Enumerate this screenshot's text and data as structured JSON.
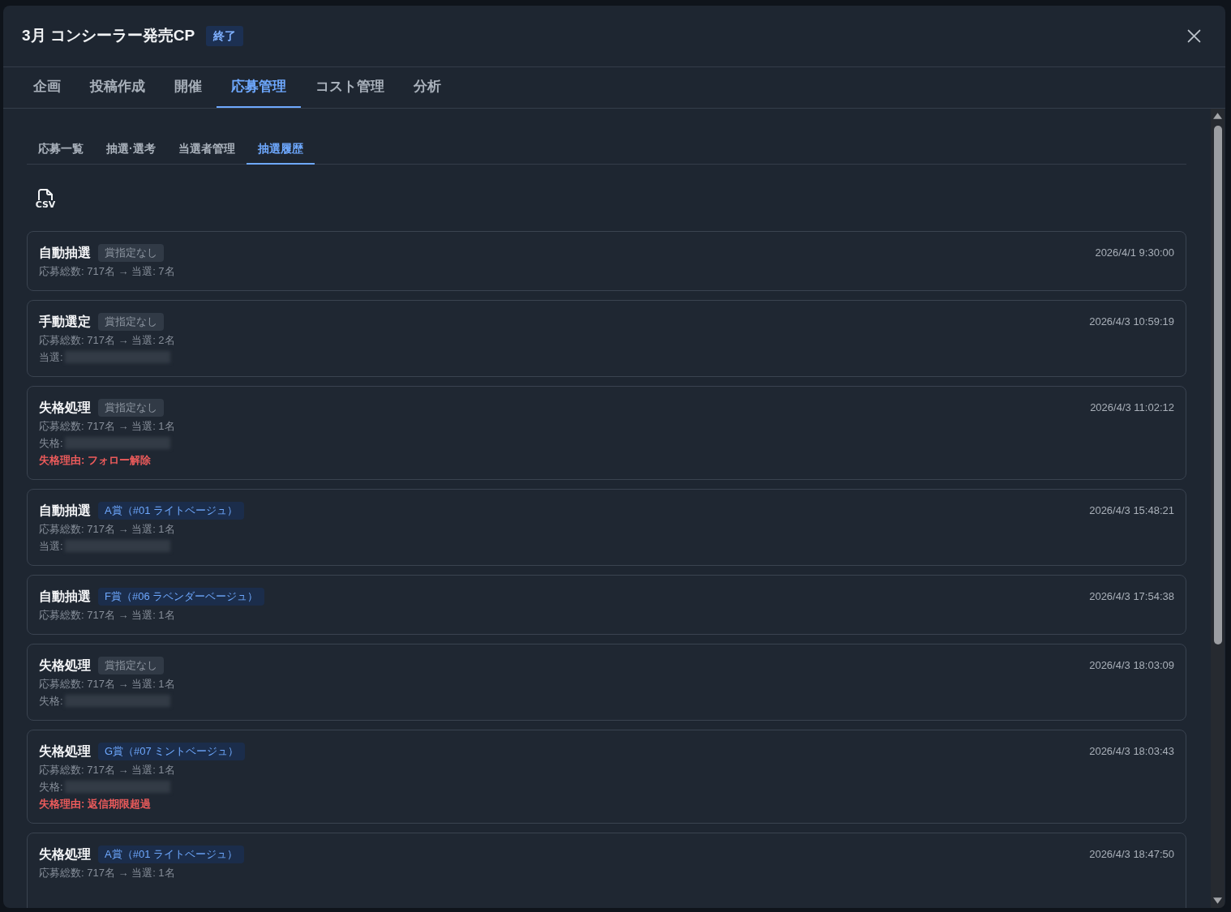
{
  "window": {
    "title": "3月 コンシーラー発売CP",
    "status_badge": "終了"
  },
  "tabs": [
    {
      "label": "企画",
      "selected": false
    },
    {
      "label": "投稿作成",
      "selected": false
    },
    {
      "label": "開催",
      "selected": false
    },
    {
      "label": "応募管理",
      "selected": true
    },
    {
      "label": "コスト管理",
      "selected": false
    },
    {
      "label": "分析",
      "selected": false
    }
  ],
  "subtabs": [
    {
      "label": "応募一覧",
      "selected": false
    },
    {
      "label": "抽選·選考",
      "selected": false
    },
    {
      "label": "当選者管理",
      "selected": false
    },
    {
      "label": "抽選履歴",
      "selected": true
    }
  ],
  "csv_button": {
    "label": "CSV"
  },
  "history": [
    {
      "method": "自動抽選",
      "prize": {
        "kind": "none",
        "label": "賞指定なし"
      },
      "timestamp": "2026/4/1 9:30:00",
      "summary": "応募総数: 717名 → 当選: 7名"
    },
    {
      "method": "手動選定",
      "prize": {
        "kind": "none",
        "label": "賞指定なし"
      },
      "timestamp": "2026/4/3 10:59:19",
      "summary": "応募総数: 717名 → 当選: 2名",
      "details": [
        {
          "kind": "masked",
          "label": "当選:"
        }
      ]
    },
    {
      "method": "失格処理",
      "prize": {
        "kind": "none",
        "label": "賞指定なし"
      },
      "timestamp": "2026/4/3 11:02:12",
      "summary": "応募総数: 717名 → 当選: 1名",
      "details": [
        {
          "kind": "masked",
          "label": "失格:"
        },
        {
          "kind": "reason",
          "text": "失格理由: フォロー解除"
        }
      ]
    },
    {
      "method": "自動抽選",
      "prize": {
        "kind": "prize",
        "label": "A賞（#01 ライトベージュ）"
      },
      "timestamp": "2026/4/3 15:48:21",
      "summary": "応募総数: 717名 → 当選: 1名",
      "details": [
        {
          "kind": "masked",
          "label": "当選:"
        }
      ]
    },
    {
      "method": "自動抽選",
      "prize": {
        "kind": "prize",
        "label": "F賞（#06 ラベンダーベージュ）"
      },
      "timestamp": "2026/4/3 17:54:38",
      "summary": "応募総数: 717名 → 当選: 1名"
    },
    {
      "method": "失格処理",
      "prize": {
        "kind": "none",
        "label": "賞指定なし"
      },
      "timestamp": "2026/4/3 18:03:09",
      "summary": "応募総数: 717名 → 当選: 1名",
      "details": [
        {
          "kind": "masked",
          "label": "失格:"
        }
      ]
    },
    {
      "method": "失格処理",
      "prize": {
        "kind": "prize",
        "label": "G賞（#07 ミントベージュ）"
      },
      "timestamp": "2026/4/3 18:03:43",
      "summary": "応募総数: 717名 → 当選: 1名",
      "details": [
        {
          "kind": "masked",
          "label": "失格:"
        },
        {
          "kind": "reason",
          "text": "失格理由: 返信期限超過"
        }
      ]
    },
    {
      "method": "失格処理",
      "prize": {
        "kind": "prize",
        "label": "A賞（#01 ライトベージュ）"
      },
      "timestamp": "2026/4/3 18:47:50",
      "summary": "応募総数: 717名 → 当選: 1名"
    }
  ]
}
